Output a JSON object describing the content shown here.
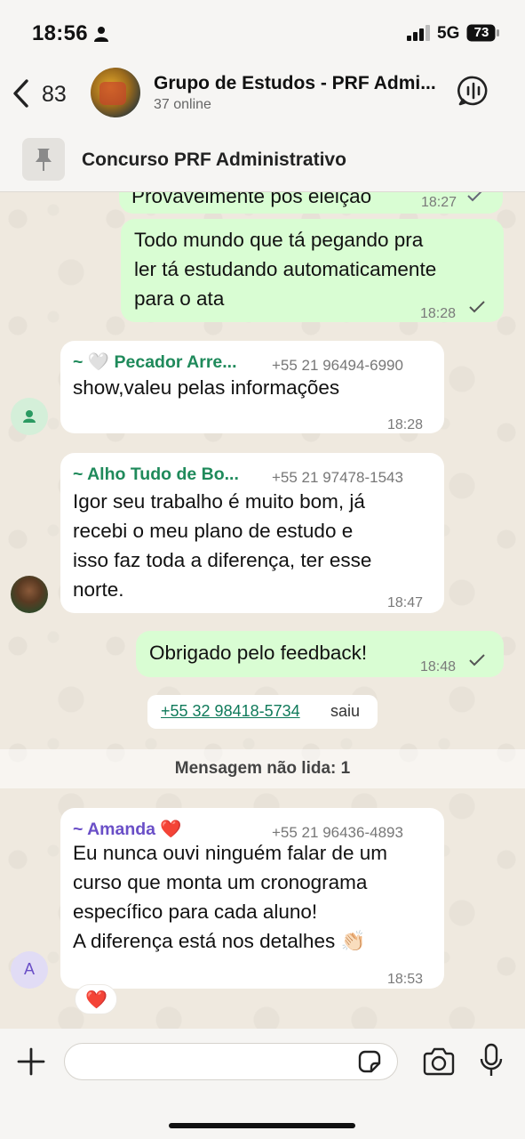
{
  "status_bar": {
    "time": "18:56",
    "network": "5G",
    "battery": "73"
  },
  "header": {
    "back_count": "83",
    "title": "Grupo de Estudos - PRF Admi...",
    "subtitle": "37 online"
  },
  "pinned": {
    "text": "Concurso PRF Administrativo"
  },
  "messages": {
    "m0": {
      "text": "Provavelmente pós eleição",
      "time": "18:27"
    },
    "m1": {
      "lines": [
        "Todo mundo que tá pegando pra",
        "ler tá estudando automaticamente",
        "para o ata"
      ],
      "time": "18:28"
    },
    "m2": {
      "sender": "~ 🤍 Pecador Arre...",
      "phone": "+55 21 96494-6990",
      "lines": [
        "show,valeu pelas informações"
      ],
      "time": "18:28"
    },
    "m3": {
      "sender": "~ Alho Tudo de Bo...",
      "phone": "+55 21 97478-1543",
      "lines": [
        "Igor seu trabalho é muito bom, já",
        "recebi o meu plano de estudo e",
        "isso faz toda a diferença, ter esse",
        "norte."
      ],
      "time": "18:47"
    },
    "m4": {
      "text": "Obrigado pelo feedback!",
      "time": "18:48"
    },
    "system": {
      "phone": "+55 32 98418-5734",
      "action": "saiu"
    },
    "unread": "Mensagem não lida: 1",
    "m5": {
      "sender": "~ Amanda ❤️",
      "phone": "+55 21 96436-4893",
      "lines": [
        "Eu nunca ouvi ninguém falar de um",
        "curso que monta um cronograma",
        "específico para cada aluno!",
        "A diferença está nos detalhes 👏🏻"
      ],
      "time": "18:53",
      "avatar_letter": "A",
      "reaction": "❤️"
    }
  },
  "colors": {
    "outgoing_bubble": "#d9fdd3",
    "incoming_bubble": "#ffffff",
    "sender_green": "#1f8a5b",
    "sender_purple": "#6a4fc7",
    "link_green": "#0f7a5a"
  },
  "icons": {
    "back": "chevron-left-icon",
    "call": "voice-chat-icon",
    "pin": "pin-icon",
    "plus": "plus-icon",
    "sticker": "sticker-icon",
    "camera": "camera-icon",
    "mic": "microphone-icon"
  }
}
